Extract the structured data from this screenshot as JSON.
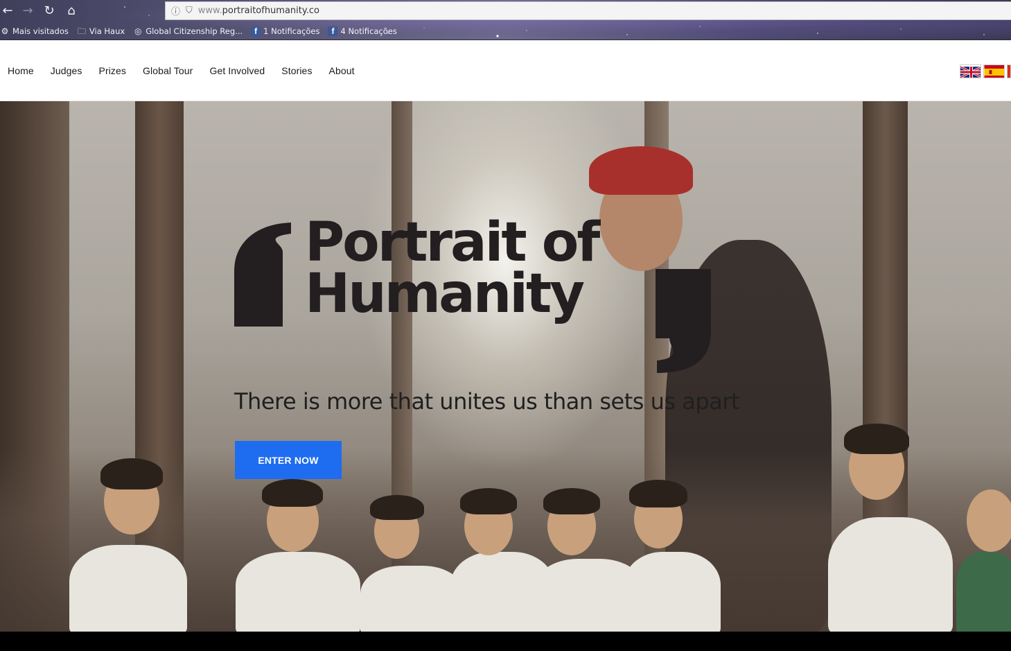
{
  "browser": {
    "url_prefix": "www.",
    "url_domain": "portraitofhumanity.co",
    "bookmarks": [
      {
        "label": "Mais visitados",
        "icon": "gear-icon"
      },
      {
        "label": "Via Haux",
        "icon": "folder-icon"
      },
      {
        "label": "Global Citizenship Reg...",
        "icon": "globe-icon"
      },
      {
        "label": "1 Notificações",
        "icon": "facebook-icon"
      },
      {
        "label": "4 Notificações",
        "icon": "facebook-icon"
      }
    ]
  },
  "nav": {
    "items": [
      "Home",
      "Judges",
      "Prizes",
      "Global Tour",
      "Get Involved",
      "Stories",
      "About"
    ]
  },
  "languages": [
    "English",
    "Español",
    "Português"
  ],
  "hero": {
    "logo_line1": "Portrait of",
    "logo_line2": "Humanity",
    "tagline": "There is more that unites us than sets us apart",
    "cta_label": "ENTER NOW",
    "cta_color": "#1e6cf0"
  }
}
